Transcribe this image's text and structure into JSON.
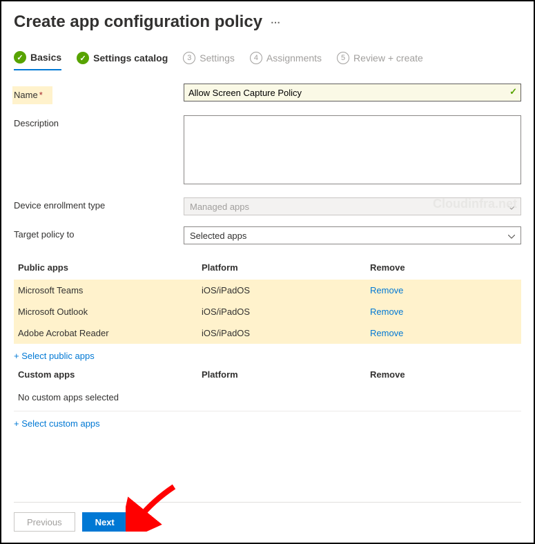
{
  "title": "Create app configuration policy",
  "wizard": [
    {
      "label": "Basics",
      "state": "active",
      "badge": "✓"
    },
    {
      "label": "Settings catalog",
      "state": "done",
      "badge": "✓"
    },
    {
      "label": "Settings",
      "state": "pending",
      "badge": "3"
    },
    {
      "label": "Assignments",
      "state": "pending",
      "badge": "4"
    },
    {
      "label": "Review + create",
      "state": "pending",
      "badge": "5"
    }
  ],
  "form": {
    "name_label": "Name",
    "name_value": "Allow Screen Capture Policy",
    "desc_label": "Description",
    "desc_value": "",
    "enroll_label": "Device enrollment type",
    "enroll_value": "Managed apps",
    "target_label": "Target policy to",
    "target_value": "Selected apps"
  },
  "public_apps": {
    "header_name": "Public apps",
    "header_platform": "Platform",
    "header_remove": "Remove",
    "rows": [
      {
        "name": "Microsoft Teams",
        "platform": "iOS/iPadOS",
        "remove": "Remove"
      },
      {
        "name": "Microsoft Outlook",
        "platform": "iOS/iPadOS",
        "remove": "Remove"
      },
      {
        "name": "Adobe Acrobat Reader",
        "platform": "iOS/iPadOS",
        "remove": "Remove"
      }
    ],
    "add_link": "+ Select public apps"
  },
  "custom_apps": {
    "header_name": "Custom apps",
    "header_platform": "Platform",
    "header_remove": "Remove",
    "empty": "No custom apps selected",
    "add_link": "+ Select custom apps"
  },
  "footer": {
    "previous": "Previous",
    "next": "Next"
  },
  "watermark": "Cloudinfra.net"
}
